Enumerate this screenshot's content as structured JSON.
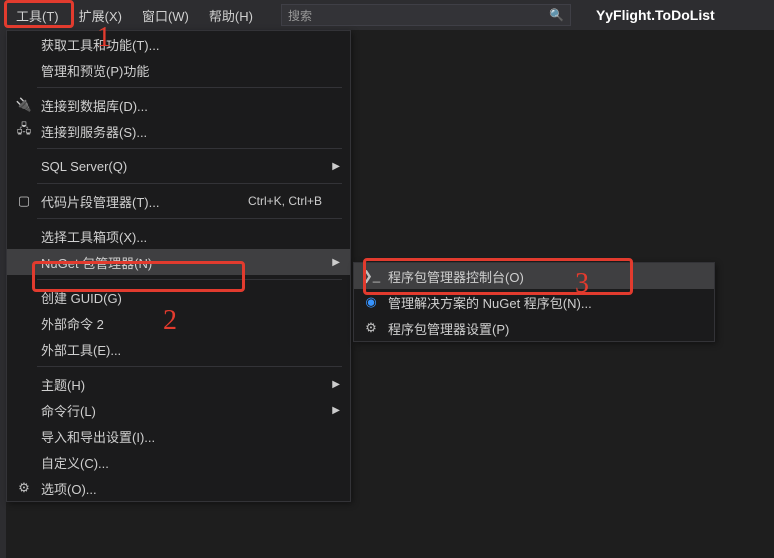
{
  "menubar": {
    "tools": "工具(T)",
    "extensions": "扩展(X)",
    "window": "窗口(W)",
    "help": "帮助(H)"
  },
  "search": {
    "placeholder": "搜索"
  },
  "project": {
    "name": "YyFlight.ToDoList"
  },
  "tools_menu": {
    "get_tools": "获取工具和功能(T)...",
    "manage_preview": "管理和预览(P)功能",
    "connect_db": "连接到数据库(D)...",
    "connect_server": "连接到服务器(S)...",
    "sql_server": "SQL Server(Q)",
    "snippet_mgr": "代码片段管理器(T)...",
    "snippet_shortcut": "Ctrl+K, Ctrl+B",
    "choose_toolbox": "选择工具箱项(X)...",
    "nuget": "NuGet 包管理器(N)",
    "create_guid": "创建 GUID(G)",
    "external_cmd2": "外部命令 2",
    "external_tools": "外部工具(E)...",
    "theme": "主题(H)",
    "command_line": "命令行(L)",
    "import_export": "导入和导出设置(I)...",
    "customize": "自定义(C)...",
    "options": "选项(O)..."
  },
  "nuget_submenu": {
    "console": "程序包管理器控制台(O)",
    "manage_solution": "管理解决方案的 NuGet 程序包(N)...",
    "settings": "程序包管理器设置(P)"
  },
  "annotations": {
    "a1": "1",
    "a2": "2",
    "a3": "3"
  }
}
